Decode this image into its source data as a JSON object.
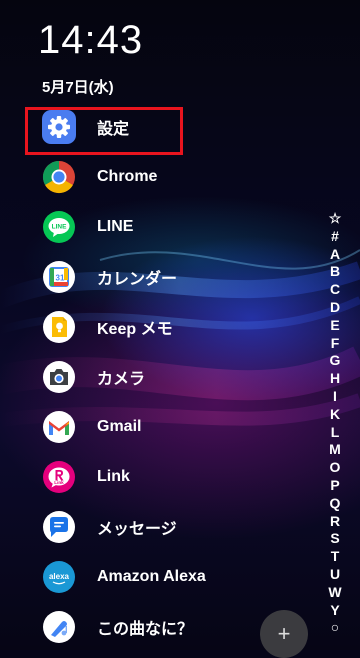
{
  "status": {
    "time": "14:43",
    "date": "5月7日(水)"
  },
  "apps": [
    {
      "label": "設定",
      "icon": "settings-gear-icon"
    },
    {
      "label": "Chrome",
      "icon": "chrome-icon"
    },
    {
      "label": "LINE",
      "icon": "line-icon"
    },
    {
      "label": "カレンダー",
      "icon": "calendar-icon"
    },
    {
      "label": "Keep メモ",
      "icon": "keep-icon"
    },
    {
      "label": "カメラ",
      "icon": "camera-icon"
    },
    {
      "label": "Gmail",
      "icon": "gmail-icon"
    },
    {
      "label": "Link",
      "icon": "rakuten-link-icon"
    },
    {
      "label": "メッセージ",
      "icon": "messages-icon"
    },
    {
      "label": "Amazon Alexa",
      "icon": "alexa-icon"
    },
    {
      "label": "この曲なに？",
      "icon": "sound-search-icon"
    }
  ],
  "icon_text": {
    "calendar": "31",
    "line": "LINE",
    "alexa": "alexa",
    "link": "Link"
  },
  "alpha_index": [
    "☆",
    "#",
    "A",
    "B",
    "C",
    "D",
    "E",
    "F",
    "G",
    "H",
    "I",
    "K",
    "L",
    "M",
    "O",
    "P",
    "Q",
    "R",
    "S",
    "T",
    "U",
    "W",
    "Y",
    "○"
  ],
  "fab_label": "+",
  "colors": {
    "highlight": "#e8141e",
    "accent": "#4285f4"
  }
}
